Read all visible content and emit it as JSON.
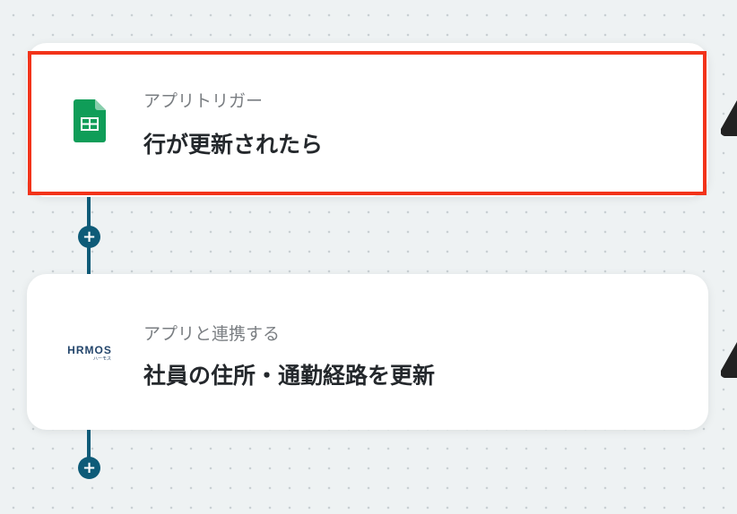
{
  "flow": {
    "steps": [
      {
        "subtitle": "アプリトリガー",
        "title": "行が更新されたら",
        "icon": "google-sheets-icon",
        "selected": true,
        "highlight_color": "#f2331a"
      },
      {
        "subtitle": "アプリと連携する",
        "title": "社員の住所・通勤経路を更新",
        "icon": "hrmos-logo",
        "logo_text": "HRMOS",
        "logo_kana": "ハーモス"
      }
    ],
    "add_button_symbol": "+",
    "connector_color": "#0e5b78"
  }
}
